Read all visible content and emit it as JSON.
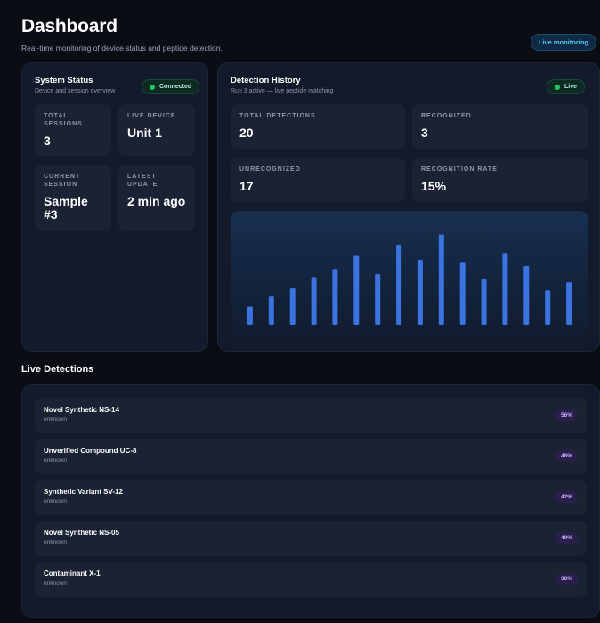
{
  "header": {
    "title": "Dashboard",
    "subtitle": "Real-time monitoring of device status and peptide detection.",
    "live_pill": "Live monitoring"
  },
  "status": {
    "title": "System Status",
    "subtitle": "Device and session overview",
    "badge": "Connected",
    "tiles": [
      {
        "label": "TOTAL SESSIONS",
        "value": "3"
      },
      {
        "label": "LIVE DEVICE",
        "value": "Unit 1"
      },
      {
        "label": "CURRENT SESSION",
        "value": "Sample #3"
      },
      {
        "label": "LATEST UPDATE",
        "value": "2 min ago"
      }
    ]
  },
  "history": {
    "title": "Detection History",
    "subtitle": "Run 3 active — live peptide matching",
    "badge": "Live",
    "stats": [
      {
        "label": "TOTAL DETECTIONS",
        "value": "20"
      },
      {
        "label": "RECOGNIZED",
        "value": "3"
      },
      {
        "label": "UNRECOGNIZED",
        "value": "17"
      },
      {
        "label": "RECOGNITION RATE",
        "value": "15%"
      }
    ]
  },
  "chart_data": {
    "type": "bar",
    "values": [
      18,
      28,
      36,
      47,
      55,
      68,
      50,
      79,
      64,
      89,
      62,
      45,
      71,
      58,
      34,
      42
    ],
    "ylim": [
      0,
      100
    ],
    "bar_color": "#3b73e0"
  },
  "live": {
    "title": "Live Detections",
    "items": [
      {
        "name": "Novel Synthetic NS-14",
        "status": "unknown",
        "pct": "56%"
      },
      {
        "name": "Unverified Compound UC-8",
        "status": "unknown",
        "pct": "48%"
      },
      {
        "name": "Synthetic Variant SV-12",
        "status": "unknown",
        "pct": "42%"
      },
      {
        "name": "Novel Synthetic NS-05",
        "status": "unknown",
        "pct": "40%"
      },
      {
        "name": "Contaminant X-1",
        "status": "unknown",
        "pct": "38%"
      }
    ]
  }
}
